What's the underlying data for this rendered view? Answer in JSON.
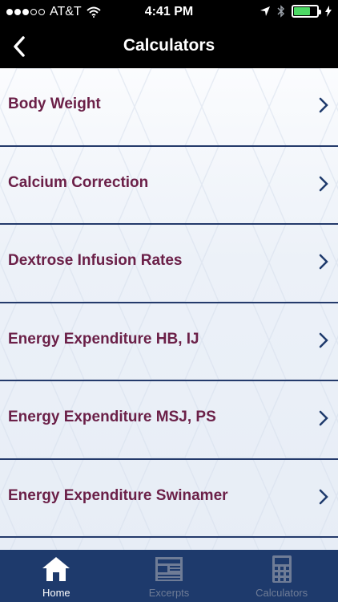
{
  "status_bar": {
    "carrier": "AT&T",
    "time": "4:41 PM",
    "signal_bars_filled": 3,
    "signal_bars_total": 5,
    "battery_level": 0.7,
    "battery_color": "#4cd964"
  },
  "nav": {
    "title": "Calculators",
    "back_icon": "chevron-left-icon"
  },
  "list": {
    "items": [
      {
        "label": "Body Weight"
      },
      {
        "label": "Calcium Correction"
      },
      {
        "label": "Dextrose Infusion Rates"
      },
      {
        "label": "Energy Expenditure HB, IJ"
      },
      {
        "label": "Energy Expenditure MSJ, PS"
      },
      {
        "label": "Energy Expenditure Swinamer"
      }
    ],
    "label_color": "#6b2048",
    "divider_color": "#243a6b"
  },
  "tab_bar": {
    "background": "#1e3a6c",
    "tabs": [
      {
        "label": "Home",
        "icon": "home-icon",
        "active": true
      },
      {
        "label": "Excerpts",
        "icon": "newspaper-icon",
        "active": false
      },
      {
        "label": "Calculators",
        "icon": "calculator-icon",
        "active": false
      }
    ]
  }
}
